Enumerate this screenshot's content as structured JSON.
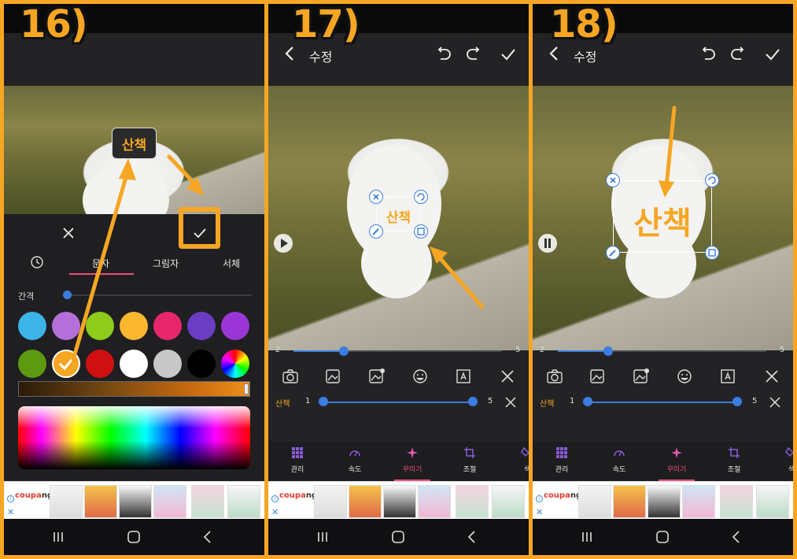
{
  "steps": [
    "16)",
    "17)",
    "18)"
  ],
  "header": {
    "title": "수정"
  },
  "panel16": {
    "preview_text": "산책",
    "tabs": [
      "문자",
      "그림자",
      "서체"
    ],
    "spacing_label": "간격",
    "swatches": [
      "#3db4e8",
      "#b56fd8",
      "#8ecb1a",
      "#fbb72e",
      "#e8266a",
      "#6b3cc4",
      "#9b36d6",
      "#5d9a10",
      "#f6a623",
      "#d01010",
      "#ffffff",
      "#c8c8c8",
      "#000000",
      "spectrum"
    ],
    "selected_swatch_index": 8
  },
  "timeline": {
    "start": "2",
    "end": "5",
    "position_fraction": 0.24
  },
  "sticker_row": {
    "name": "산책",
    "start": "1",
    "end": "5"
  },
  "sticker_text": "산책",
  "nav": [
    "관리",
    "속도",
    "꾸미기",
    "조절",
    "색"
  ],
  "active_nav_index": 2,
  "ad": {
    "brand_a": "coupa",
    "brand_b": "ng"
  },
  "colors": {
    "accent": "#f6a623",
    "blue": "#3b7de0",
    "pink": "#ef4f7a"
  },
  "icons": [
    "back-icon",
    "undo-icon",
    "redo-icon",
    "check-icon",
    "camera-icon",
    "image-icon",
    "gif-icon",
    "emoji-icon",
    "text-icon",
    "close-icon",
    "grid-icon",
    "speed-icon",
    "sparkle-icon",
    "crop-icon",
    "recent-icon",
    "back-nav-icon",
    "home-icon"
  ]
}
